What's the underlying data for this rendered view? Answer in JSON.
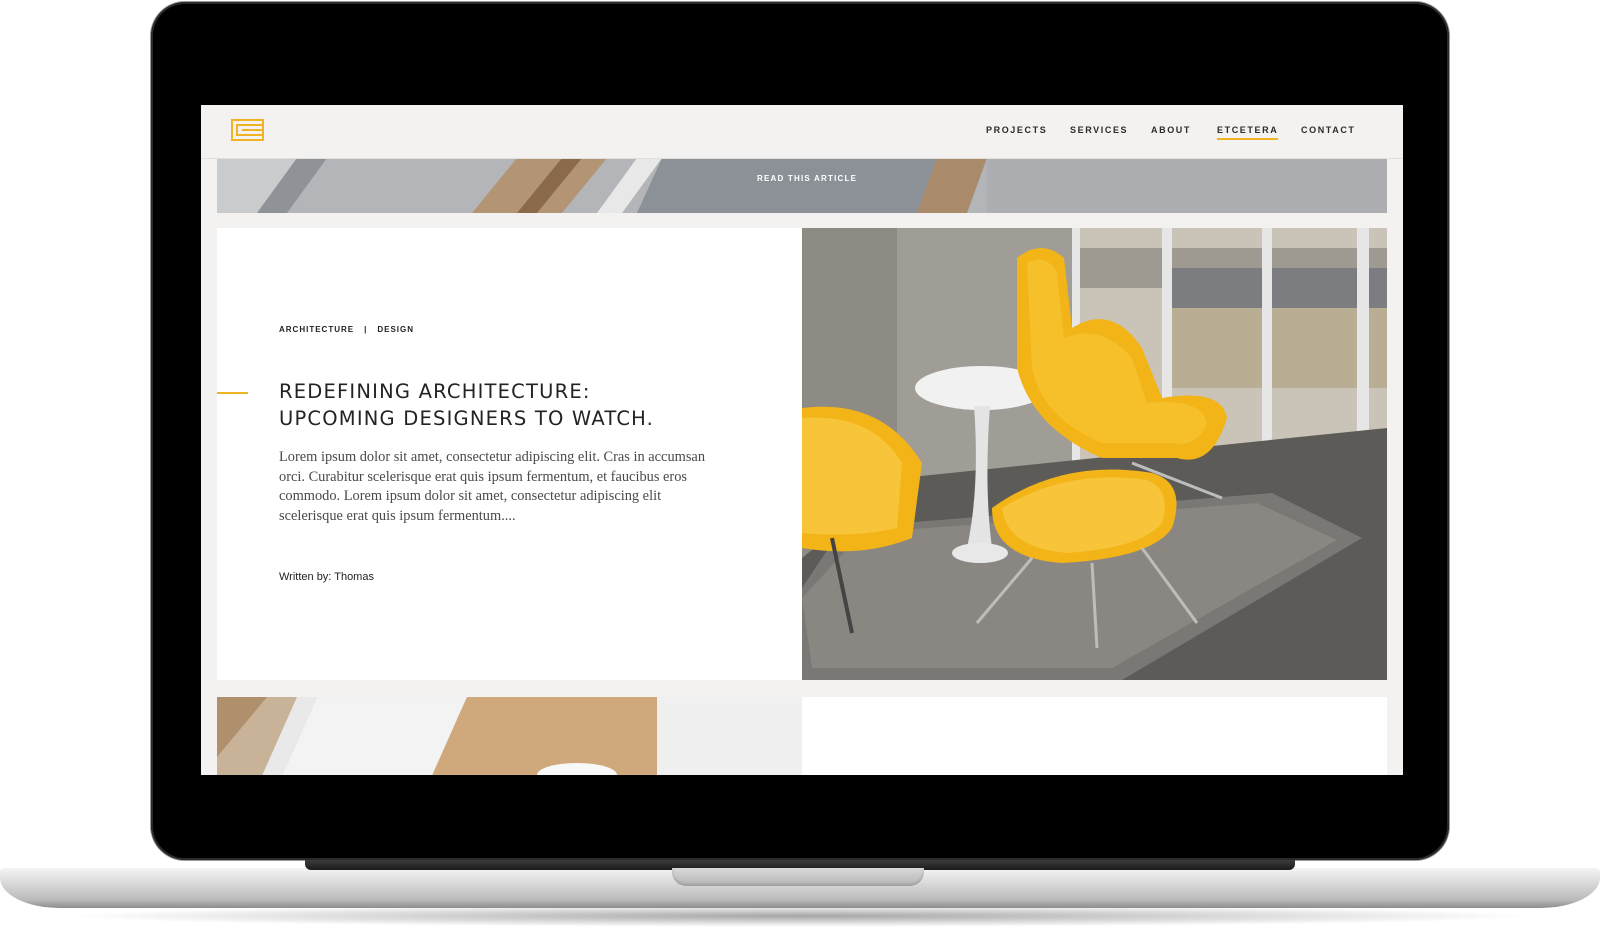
{
  "nav": {
    "items": [
      {
        "label": "PROJECTS"
      },
      {
        "label": "SERVICES"
      },
      {
        "label": "ABOUT"
      },
      {
        "label": "ETCETERA",
        "active": true
      },
      {
        "label": "CONTACT"
      }
    ]
  },
  "banner": {
    "cta_label": "READ THIS ARTICLE"
  },
  "article": {
    "tags": [
      "ARCHITECTURE",
      "DESIGN"
    ],
    "tag_separator": "|",
    "title_line1": "REDEFINING ARCHITECTURE:",
    "title_line2": "UPCOMING DESIGNERS TO WATCH.",
    "excerpt": "Lorem ipsum dolor sit amet, consectetur adipiscing elit. Cras in accumsan orci. Curabitur scelerisque erat quis ipsum fermentum, et faucibus eros commodo. Lorem ipsum dolor sit amet, consectetur adipiscing elit scelerisque erat quis ipsum fermentum....",
    "author": "Written by: Thomas"
  },
  "colors": {
    "accent": "#f0b323",
    "chair_yellow": "#f2b417",
    "nav_bg": "#f3f2f0"
  },
  "icons": {
    "logo": "brand-logo-icon"
  }
}
